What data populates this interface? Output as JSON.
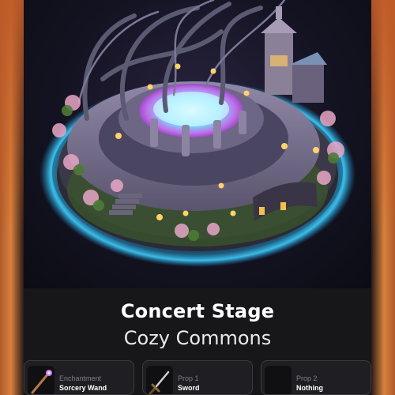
{
  "card": {
    "title": "Concert Stage",
    "subtitle": "Cozy Commons"
  },
  "slots": [
    {
      "kind": "Enchantment",
      "value": "Sorcery Wand",
      "icon": "wand-icon"
    },
    {
      "kind": "Prop 1",
      "value": "Sword",
      "icon": "sword-icon"
    },
    {
      "kind": "Prop 2",
      "value": "Nothing",
      "icon": "empty-slot-icon"
    }
  ],
  "colors": {
    "background_orange": "#d8803c",
    "panel": "#17171a",
    "slot_border": "#3a3a40",
    "portal_glow": "#5ad8ff"
  }
}
